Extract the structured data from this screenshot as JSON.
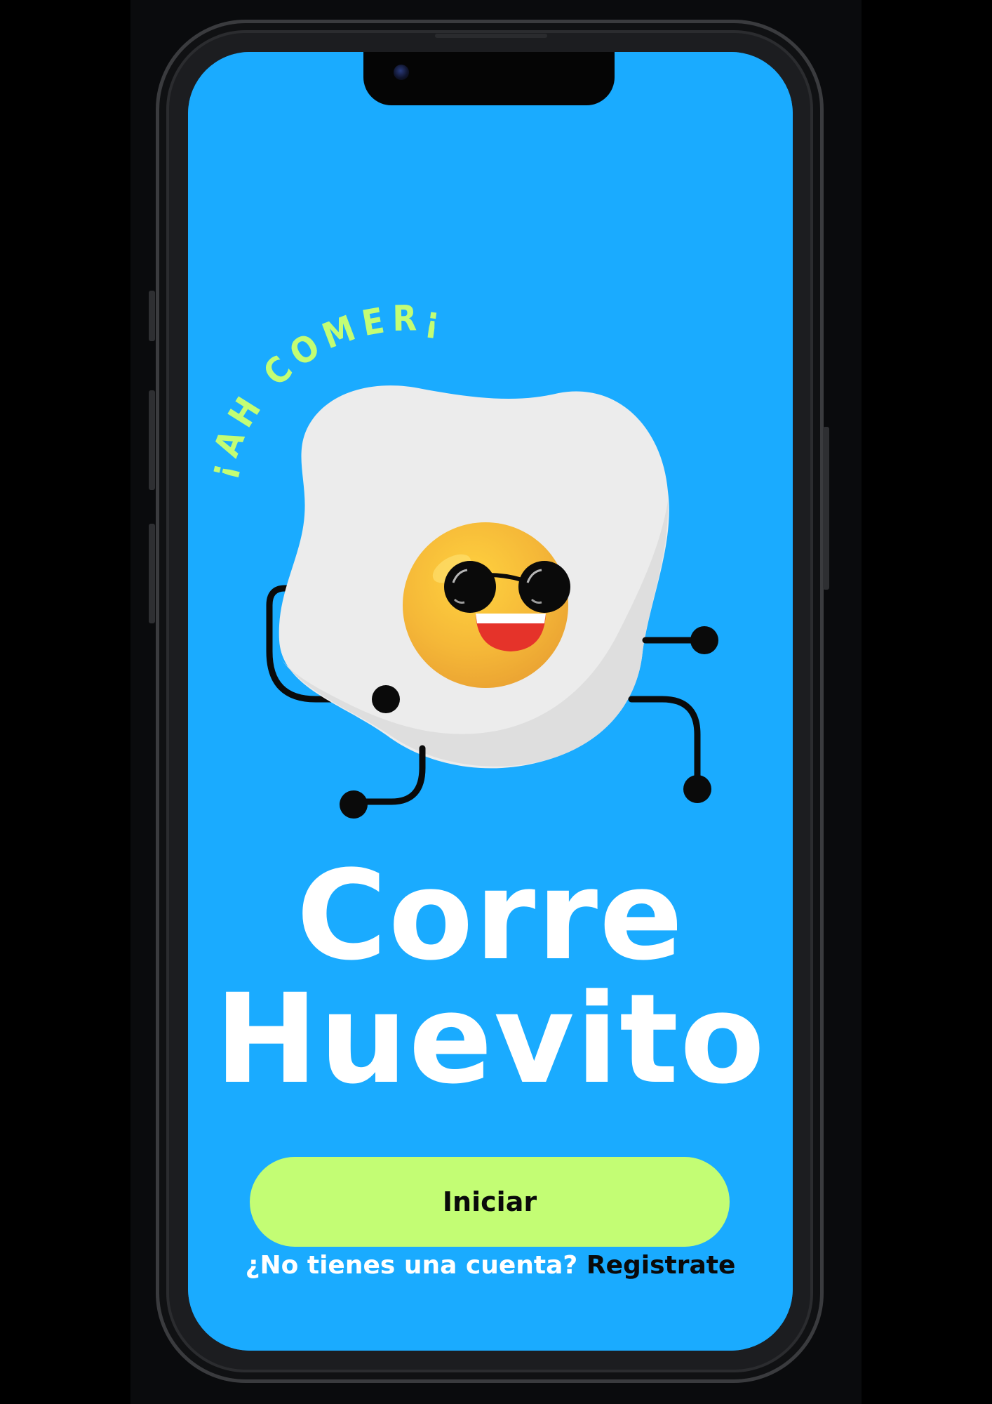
{
  "colors": {
    "screen_background": "#1aabff",
    "button_background": "#c3fd74",
    "curved_text": "#c3fd74",
    "title_text": "#ffffff",
    "link_text": "#0a0a0a"
  },
  "splash": {
    "curved_tagline": "¡AH COMER¡",
    "title_line_1": "Corre",
    "title_line_2": "Huevito",
    "mascot_icon": "fried-egg-mascot-with-sunglasses"
  },
  "actions": {
    "start_label": "Iniciar",
    "signup_prompt": "¿No tienes una cuenta?",
    "signup_link": "Registrate"
  }
}
